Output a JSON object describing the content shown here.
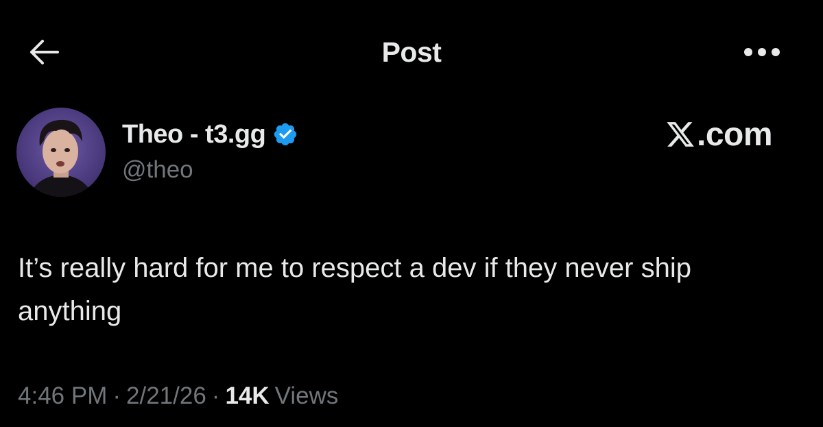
{
  "header": {
    "title": "Post",
    "back_icon": "arrow-left-icon",
    "more_icon": "more-horizontal-icon"
  },
  "author": {
    "display_name": "Theo - t3.gg",
    "handle": "@theo",
    "verified": true,
    "verified_color": "#1d9bf0"
  },
  "watermark": {
    "x_logo": "x-logo-icon",
    "text": ".com"
  },
  "post": {
    "text": "It’s really hard for me to respect a dev if they never ship anything"
  },
  "meta": {
    "time": "4:46 PM",
    "separator": "·",
    "date": "2/21/26",
    "views_count": "14K",
    "views_label": "Views"
  },
  "colors": {
    "background": "#000000",
    "primary_text": "#e7e9ea",
    "secondary_text": "#71767b",
    "accent": "#1d9bf0"
  }
}
